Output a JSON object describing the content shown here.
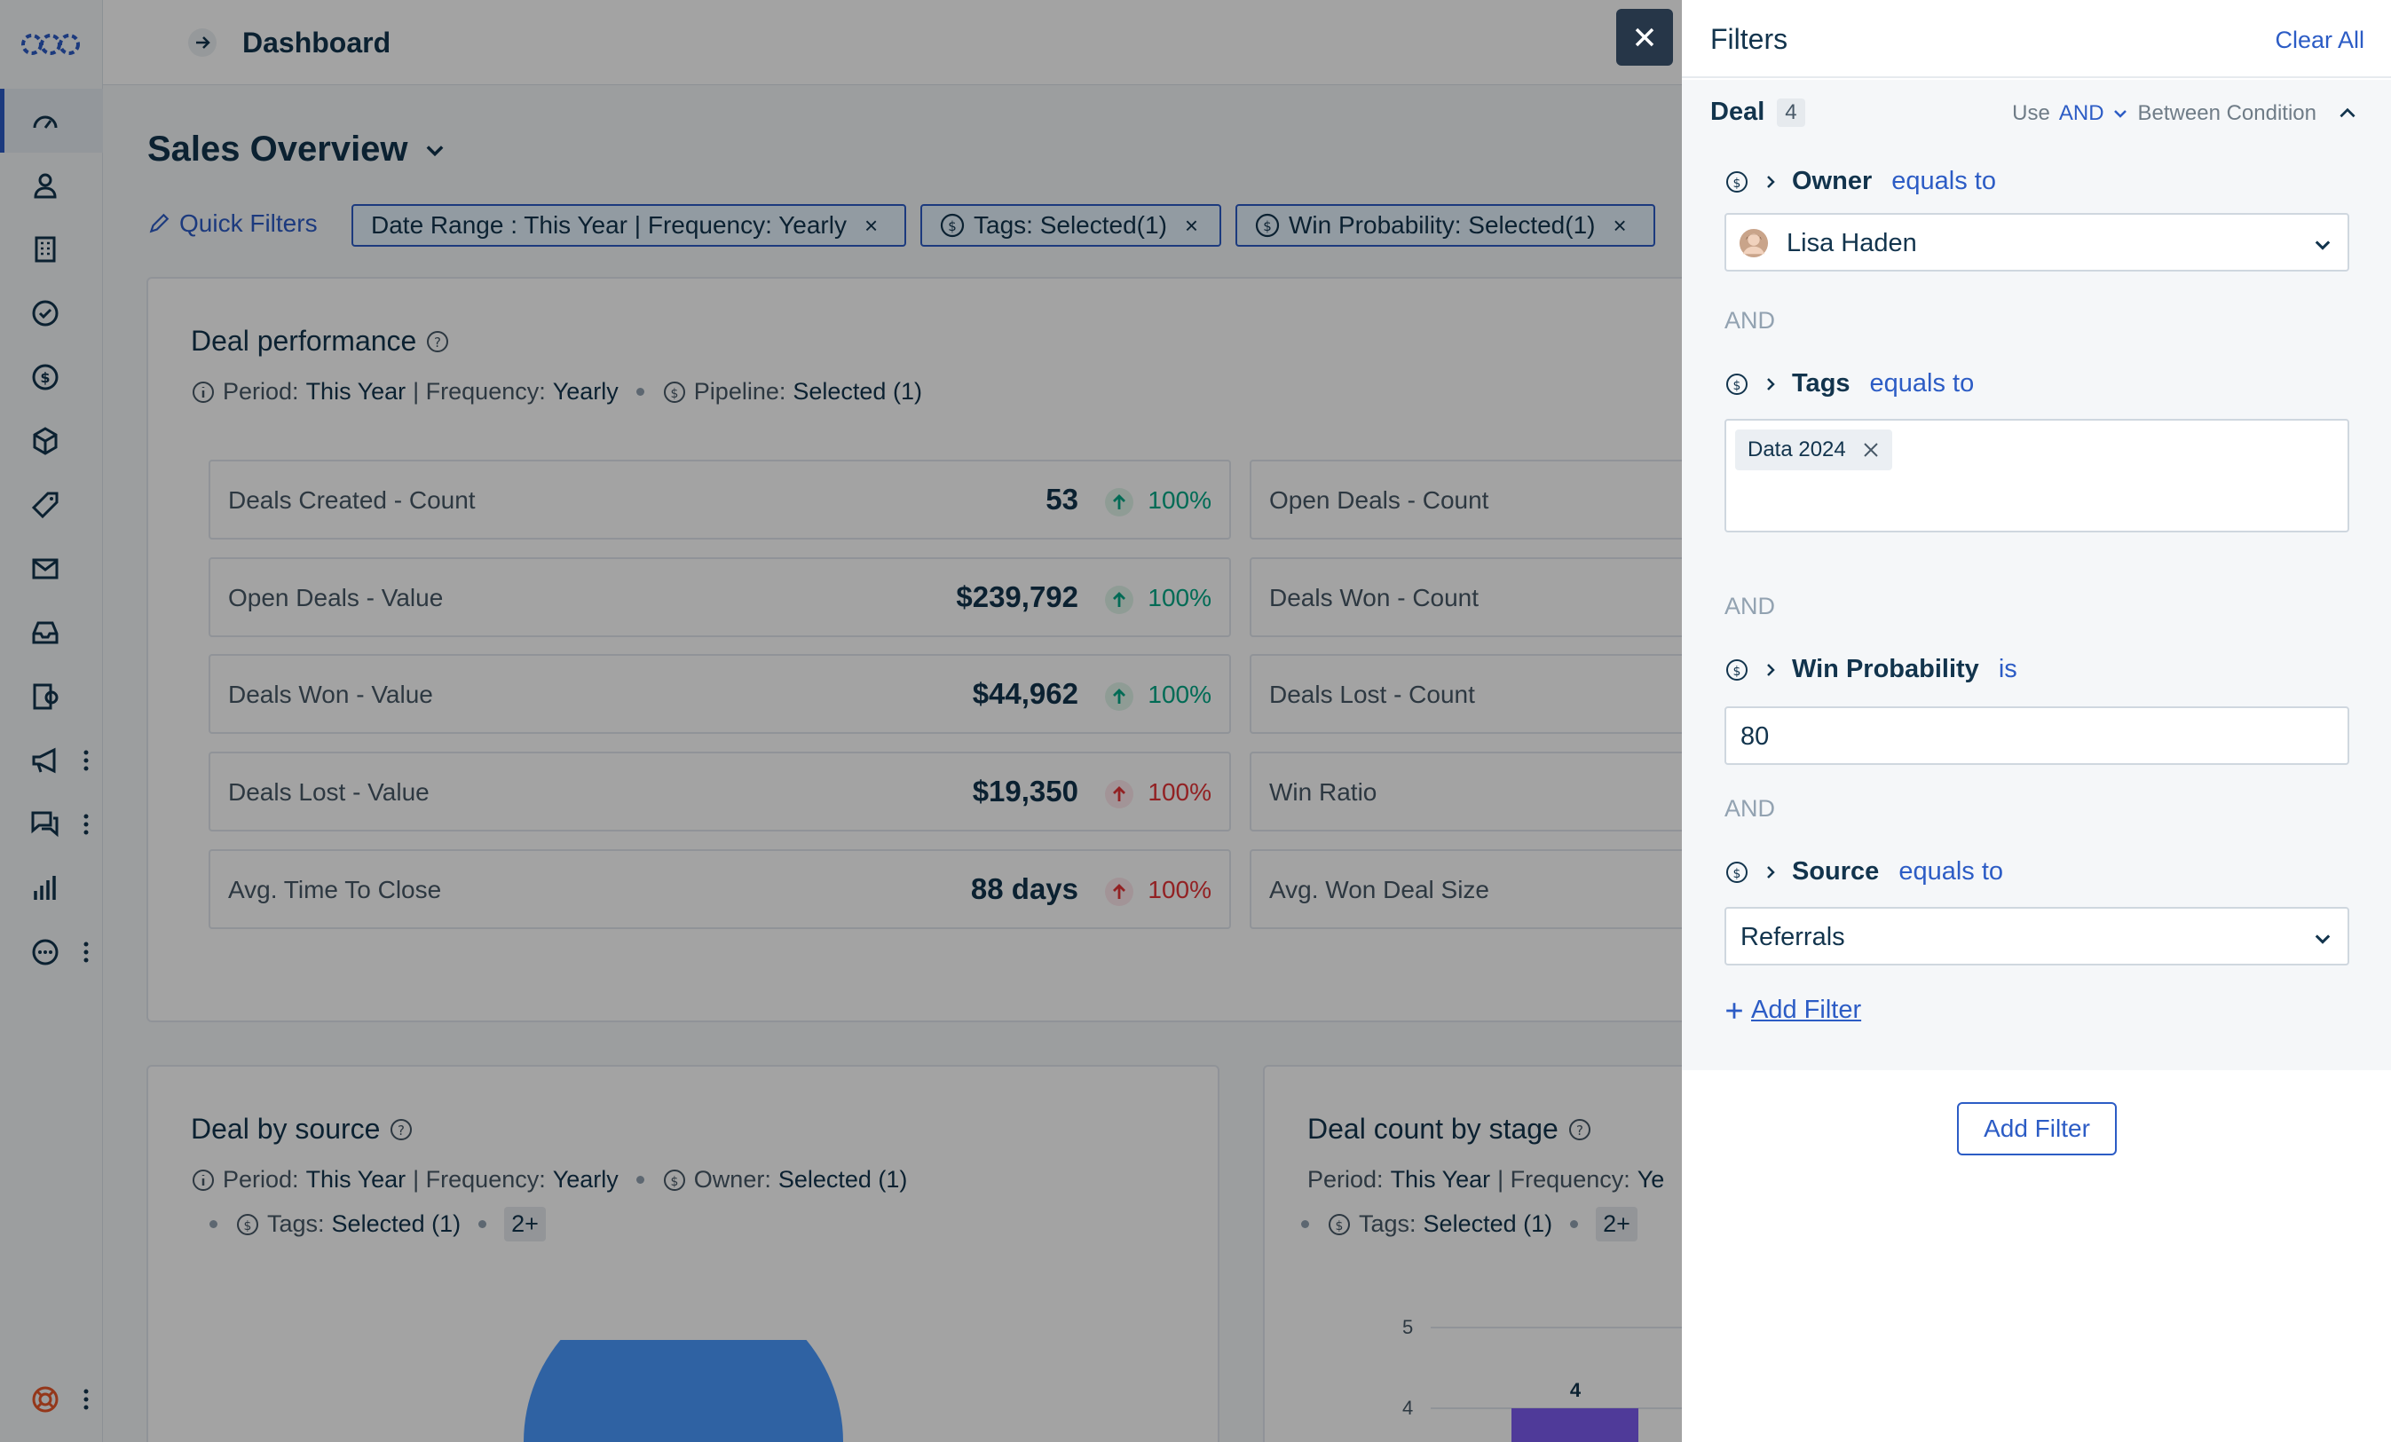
{
  "header": {
    "title": "Dashboard"
  },
  "dashboard": {
    "name": "Sales Overview",
    "quick_filters_label": "Quick Filters",
    "chips": [
      {
        "label": "Date Range : This Year | Frequency: Yearly",
        "close": "×"
      },
      {
        "label": "Tags: Selected(1)",
        "close": "×"
      },
      {
        "label": "Win Probability: Selected(1)",
        "close": "×"
      }
    ]
  },
  "deal_performance": {
    "title": "Deal performance",
    "period_label": "Period:",
    "period_value": "This Year",
    "frequency_label": "| Frequency:",
    "frequency_value": "Yearly",
    "pipeline_label": "Pipeline:",
    "pipeline_value": "Selected (1)",
    "metrics_left": [
      {
        "label": "Deals Created - Count",
        "value": "53",
        "change": "100%",
        "trend": "up"
      },
      {
        "label": "Open Deals - Value",
        "value": "$239,792",
        "change": "100%",
        "trend": "up"
      },
      {
        "label": "Deals Won - Value",
        "value": "$44,962",
        "change": "100%",
        "trend": "up"
      },
      {
        "label": "Deals Lost - Value",
        "value": "$19,350",
        "change": "100%",
        "trend": "down"
      },
      {
        "label": "Avg. Time To Close",
        "value": "88 days",
        "change": "100%",
        "trend": "down"
      }
    ],
    "metrics_right": [
      {
        "label": "Open Deals - Count"
      },
      {
        "label": "Deals Won - Count"
      },
      {
        "label": "Deals Lost - Count"
      },
      {
        "label": "Win Ratio"
      },
      {
        "label": "Avg. Won Deal Size"
      }
    ]
  },
  "deal_by_source": {
    "title": "Deal by source",
    "period_label": "Period:",
    "period_value": "This Year",
    "frequency_label": "| Frequency:",
    "frequency_value": "Yearly",
    "owner_label": "Owner:",
    "owner_value": "Selected (1)",
    "tags_label": "Tags:",
    "tags_value": "Selected (1)",
    "more": "2+"
  },
  "deal_count_by_stage": {
    "title": "Deal count by stage",
    "period_label": "Period:",
    "period_value": "This Year",
    "frequency_label": "| Frequency:",
    "frequency_value": "Ye",
    "tags_label": "Tags:",
    "tags_value": "Selected (1)",
    "more": "2+",
    "tick_top": "5",
    "tick_bottom": "4",
    "bar_label": "4"
  },
  "filters_panel": {
    "title": "Filters",
    "clear_all": "Clear All",
    "group": "Deal",
    "group_count": "4",
    "use_label": "Use",
    "operator": "AND",
    "between_label": "Between Condition",
    "and_label": "AND",
    "rows": [
      {
        "field": "Owner",
        "op": "equals to",
        "value": "Lisa Haden"
      },
      {
        "field": "Tags",
        "op": "equals to",
        "tag": "Data 2024"
      },
      {
        "field": "Win Probability",
        "op": "is",
        "value": "80"
      },
      {
        "field": "Source",
        "op": "equals to",
        "value": "Referrals"
      }
    ],
    "add_filter_link": "Add Filter",
    "add_filter_button": "Add Filter"
  },
  "colors": {
    "accent": "#2c5cc5",
    "chip_bg": "#e5f2fd",
    "positive": "#00a886",
    "negative": "#e43538",
    "pie_blue": "#4a9aff",
    "bar_purple": "#7c5cf0",
    "overlay_close": "#263648"
  },
  "icons": {
    "nav": [
      "dashboard-icon",
      "contacts-icon",
      "accounts-icon",
      "tasks-icon",
      "deals-icon",
      "products-icon",
      "tags-icon",
      "email-icon",
      "inbox-icon",
      "documents-icon",
      "campaigns-icon",
      "conversations-icon",
      "reports-icon",
      "more-icon",
      "help-icon"
    ]
  }
}
